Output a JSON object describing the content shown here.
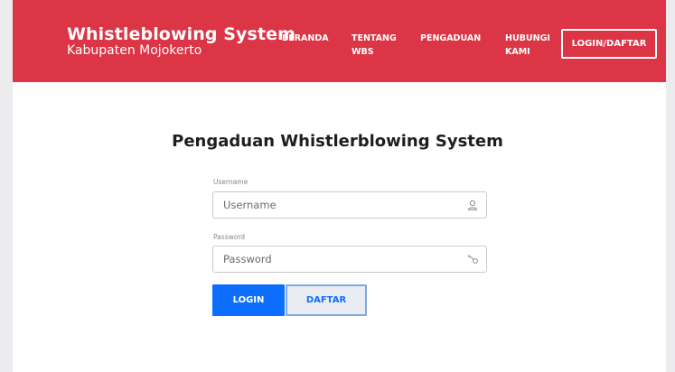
{
  "header": {
    "brand_title": "Whistleblowing System",
    "brand_subtitle": "Kabupaten Mojokerto",
    "nav": [
      {
        "label_line1": "BERANDA",
        "label_line2": ""
      },
      {
        "label_line1": "TENTANG",
        "label_line2": "WBS"
      },
      {
        "label_line1": "PENGADUAN",
        "label_line2": ""
      },
      {
        "label_line1": "HUBUNGI",
        "label_line2": "KAMI"
      }
    ],
    "login_button": "LOGIN/DAFTAR"
  },
  "form": {
    "title": "Pengaduan Whistlerblowing System",
    "username": {
      "label": "Username",
      "placeholder": "Username",
      "value": "",
      "icon": "user-icon"
    },
    "password": {
      "label": "Password",
      "placeholder": "Password",
      "value": "",
      "icon": "key-icon"
    },
    "login_button": "LOGIN",
    "register_button": "DAFTAR"
  },
  "colors": {
    "header_bg": "#dc3545",
    "primary": "#0d6efd",
    "secondary_bg": "#e9edf3"
  }
}
